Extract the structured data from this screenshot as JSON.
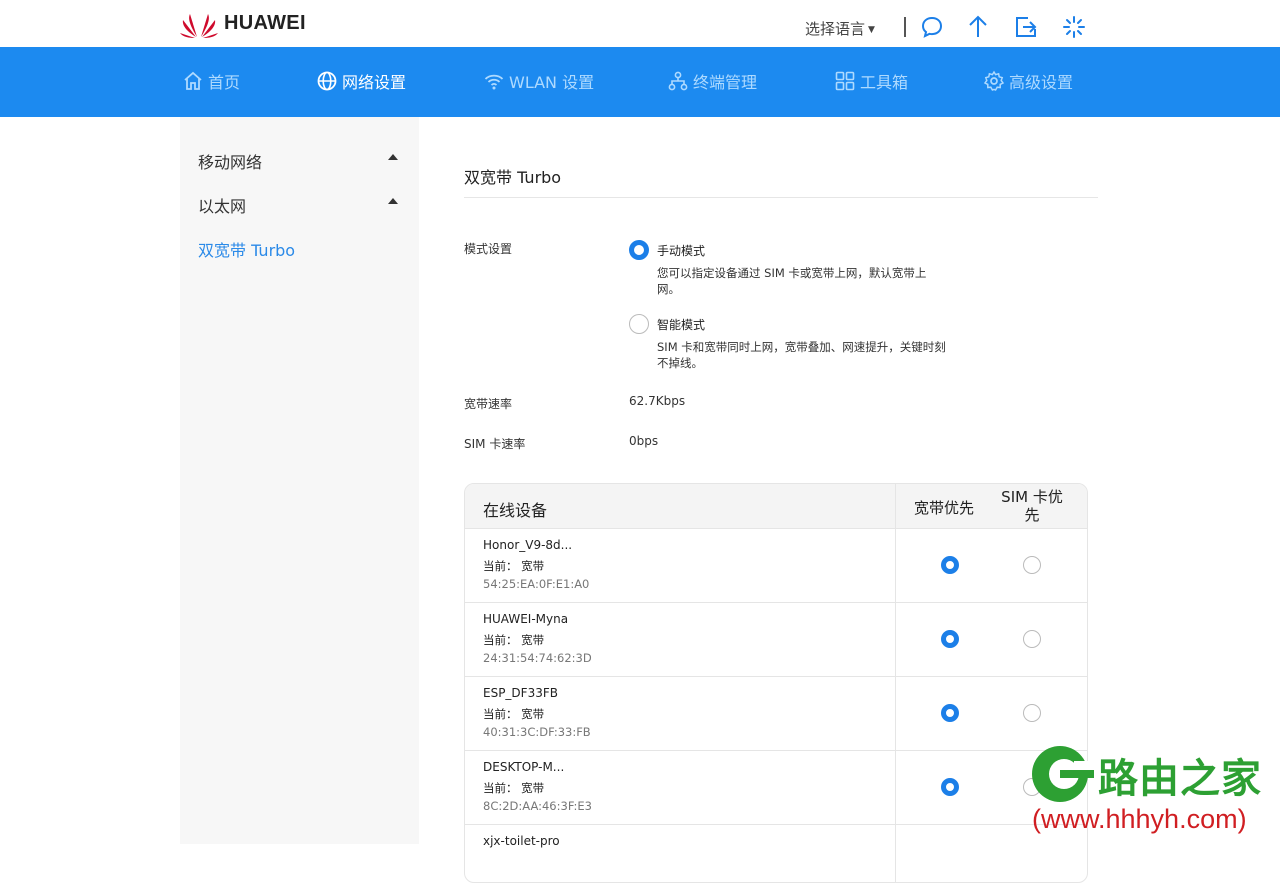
{
  "brand": {
    "name": "HUAWEI",
    "color": "#cf0a2c"
  },
  "header": {
    "language_label": "选择语言",
    "icons": [
      "chat-icon",
      "upload-icon",
      "logout-icon",
      "loading-icon"
    ]
  },
  "colors": {
    "nav_bg": "#1c8af0",
    "accent": "#1c7fe8",
    "sidebar_active": "#2b8ae8"
  },
  "nav": {
    "items": [
      {
        "label": "首页",
        "icon": "home-icon",
        "active": false
      },
      {
        "label": "网络设置",
        "icon": "globe-icon",
        "active": true
      },
      {
        "label": "WLAN 设置",
        "icon": "wifi-icon",
        "active": false
      },
      {
        "label": "终端管理",
        "icon": "device-tree-icon",
        "active": false
      },
      {
        "label": "工具箱",
        "icon": "toolbox-icon",
        "active": false
      },
      {
        "label": "高级设置",
        "icon": "gear-icon",
        "active": false
      }
    ]
  },
  "sidebar": {
    "items": [
      {
        "label": "移动网络",
        "expandable": true,
        "active": false
      },
      {
        "label": "以太网",
        "expandable": true,
        "active": false
      },
      {
        "label": "双宽带 Turbo",
        "expandable": false,
        "active": true
      }
    ]
  },
  "main": {
    "title": "双宽带 Turbo",
    "mode": {
      "label": "模式设置",
      "options": [
        {
          "title": "手动模式",
          "desc": "您可以指定设备通过 SIM 卡或宽带上网，默认宽带上网。",
          "selected": true
        },
        {
          "title": "智能模式",
          "desc": "SIM 卡和宽带同时上网，宽带叠加、网速提升，关键时刻不掉线。",
          "selected": false
        }
      ]
    },
    "broadband_rate": {
      "label": "宽带速率",
      "value": "62.7Kbps"
    },
    "sim_rate": {
      "label": "SIM 卡速率",
      "value": "0bps"
    }
  },
  "devices": {
    "header": {
      "device": "在线设备",
      "broadband_first": "宽带优先",
      "sim_first": "SIM 卡优先"
    },
    "rows": [
      {
        "name": "Honor_V9-8d...",
        "current": "当前： 宽带",
        "mac": "54:25:EA:0F:E1:A0",
        "priority": "broadband"
      },
      {
        "name": "HUAWEI-Myna",
        "current": "当前： 宽带",
        "mac": "24:31:54:74:62:3D",
        "priority": "broadband"
      },
      {
        "name": "ESP_DF33FB",
        "current": "当前： 宽带",
        "mac": "40:31:3C:DF:33:FB",
        "priority": "broadband"
      },
      {
        "name": "DESKTOP-M...",
        "current": "当前： 宽带",
        "mac": "8C:2D:AA:46:3F:E3",
        "priority": "broadband"
      },
      {
        "name": "xjx-toilet-pro",
        "current": "",
        "mac": "",
        "priority": "broadband"
      }
    ]
  },
  "watermark": {
    "text": "路由之家",
    "url": "(www.hhhyh.com)"
  }
}
